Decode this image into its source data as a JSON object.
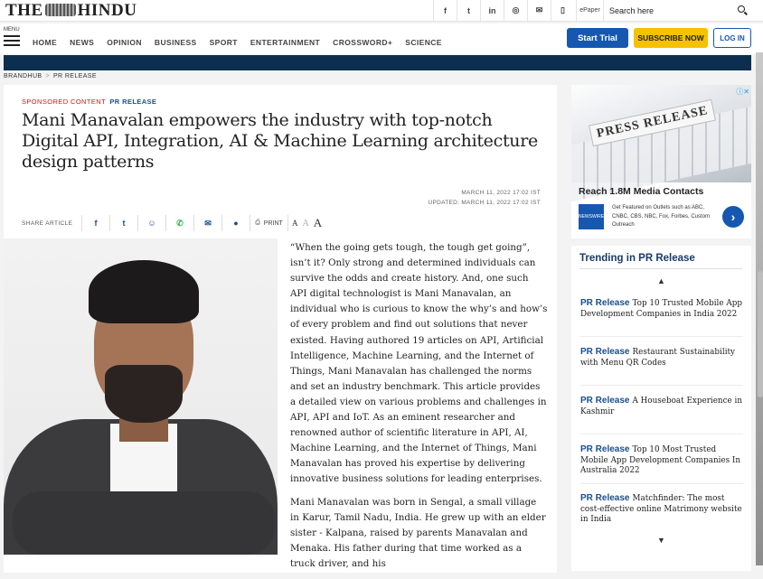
{
  "header": {
    "logo_left": "THE",
    "logo_right": "HINDU",
    "social_icons": [
      "facebook-icon",
      "twitter-icon",
      "linkedin-icon",
      "instagram-icon",
      "mail-icon",
      "mobile-icon"
    ],
    "social_glyphs": [
      "f",
      "t",
      "in",
      "◎",
      "✉",
      "▯"
    ],
    "epaper": "ePaper",
    "search_placeholder": "Search here"
  },
  "nav": {
    "menu_label": "MENU",
    "links": [
      "HOME",
      "NEWS",
      "OPINION",
      "BUSINESS",
      "SPORT",
      "ENTERTAINMENT",
      "CROSSWORD+",
      "SCIENCE"
    ],
    "start_trial": "Start Trial",
    "subscribe": "SUBSCRIBE NOW",
    "login": "LOG IN"
  },
  "breadcrumb": {
    "items": [
      "BRANDHUB",
      "PR RELEASE"
    ],
    "separator": ">"
  },
  "article": {
    "sponsored": "SPONSORED CONTENT",
    "section": "PR RELEASE",
    "headline": "Mani Manavalan empowers the industry with top-notch Digital API, Integration, AI & Machine Learning architecture design patterns",
    "published": "MARCH 11, 2022 17:02 IST",
    "updated": "UPDATED: MARCH 11, 2022 17:02 IST",
    "share_label": "SHARE ARTICLE",
    "print_label": "PRINT",
    "font_sizes": [
      "A",
      "A",
      "A"
    ],
    "paragraphs": [
      "“When the going gets tough, the tough get going”, isn’t it? Only strong and determined individuals can survive the odds and create history. And, one such API digital technologist is Mani Manavalan, an individual who is curious to know the why’s and how’s of every problem and find out solutions that never existed. Having authored 19 articles on API, Artificial Intelligence, Machine Learning, and the Internet of Things, Mani Manavalan has challenged the norms and set an industry benchmark. This article provides a detailed view on various problems and challenges in API, API and IoT. As an eminent researcher and renowned author of scientific literature in API, AI, Machine Learning, and the Internet of Things, Mani Manavalan has proved his expertise by delivering innovative business solutions for leading enterprises.",
      "Mani Manavalan was born in Sengal, a small village in Karur, Tamil Nadu, India. He grew up with an elder sister - Kalpana, raised by parents Manavalan and Menaka. His father during that time worked as a truck driver, and his"
    ]
  },
  "ad": {
    "banner_text": "PRESS RELEASE",
    "headline": "Reach 1.8M Media Contacts",
    "thumb_text": "NEWSWIRE",
    "body": "Get Featured on Outlets such as ABC, CNBC, CBS, NBC, Fox, Forbes, Custom Outreach",
    "go": "›"
  },
  "trending": {
    "title": "Trending in PR Release",
    "tag": "PR Release",
    "up_arrow": "▲",
    "down_arrow": "▼",
    "items": [
      "Top 10 Trusted Mobile App Development Companies in India 2022",
      "Restaurant Sustainability with Menu QR Codes",
      "A Houseboat Experience in Kashmir",
      "Top 10 Most Trusted Mobile App Development Companies In Australia 2022",
      "Matchfinder: The most cost-effective online Matrimony website in India"
    ]
  },
  "colors": {
    "brand_blue": "#1658b0",
    "subscribe_yellow": "#f6c100",
    "nav_dark": "#0d2f4f",
    "sponsored_red": "#c41b1b"
  }
}
